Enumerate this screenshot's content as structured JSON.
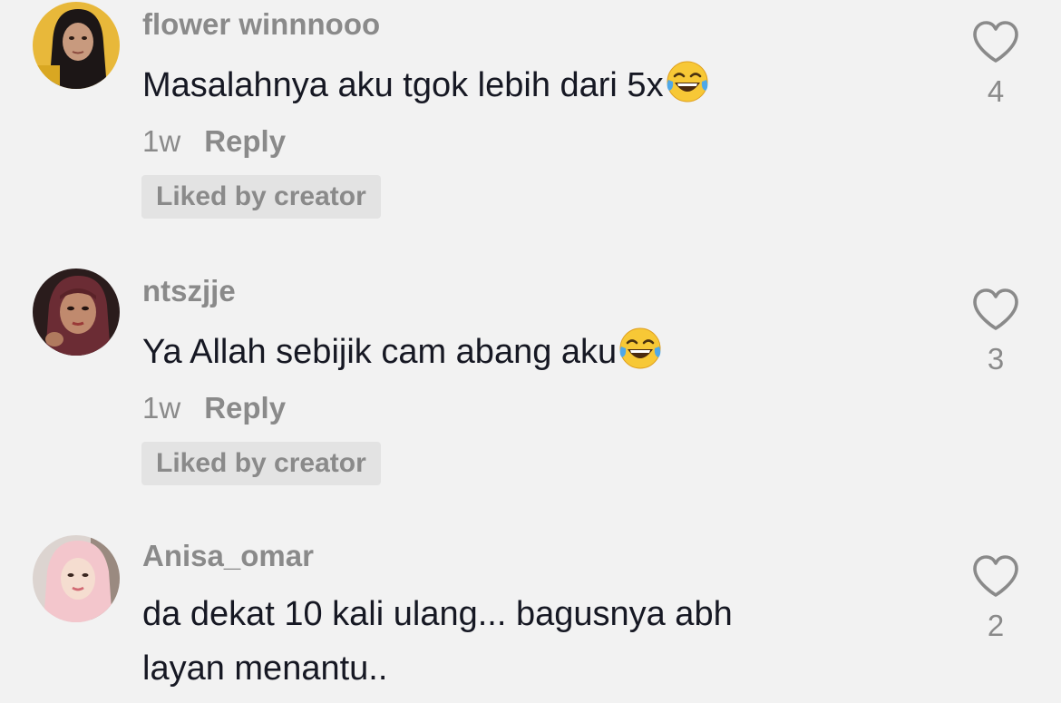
{
  "comments": [
    {
      "username": "flower winnnooo",
      "text": "Masalahnya aku tgok lebih dari 5x",
      "emoji": "laughing-tears-emoji",
      "time": "1w",
      "reply": "Reply",
      "badge": "Liked by creator",
      "likes": "4"
    },
    {
      "username": "ntszjje",
      "text": "Ya Allah sebijik cam abang aku",
      "emoji": "laughing-tears-emoji",
      "time": "1w",
      "reply": "Reply",
      "badge": "Liked by creator",
      "likes": "3"
    },
    {
      "username": "Anisa_omar",
      "text_line1": "da dekat 10 kali ulang... bagusnya abh",
      "text_line2": "layan menantu..",
      "likes": "2"
    }
  ],
  "icons": {
    "like": "heart-outline-icon"
  },
  "colors": {
    "background": "#f2f2f2",
    "secondary_text": "#8a8a8a",
    "primary_text": "#161823",
    "badge_bg": "#e3e3e3"
  }
}
